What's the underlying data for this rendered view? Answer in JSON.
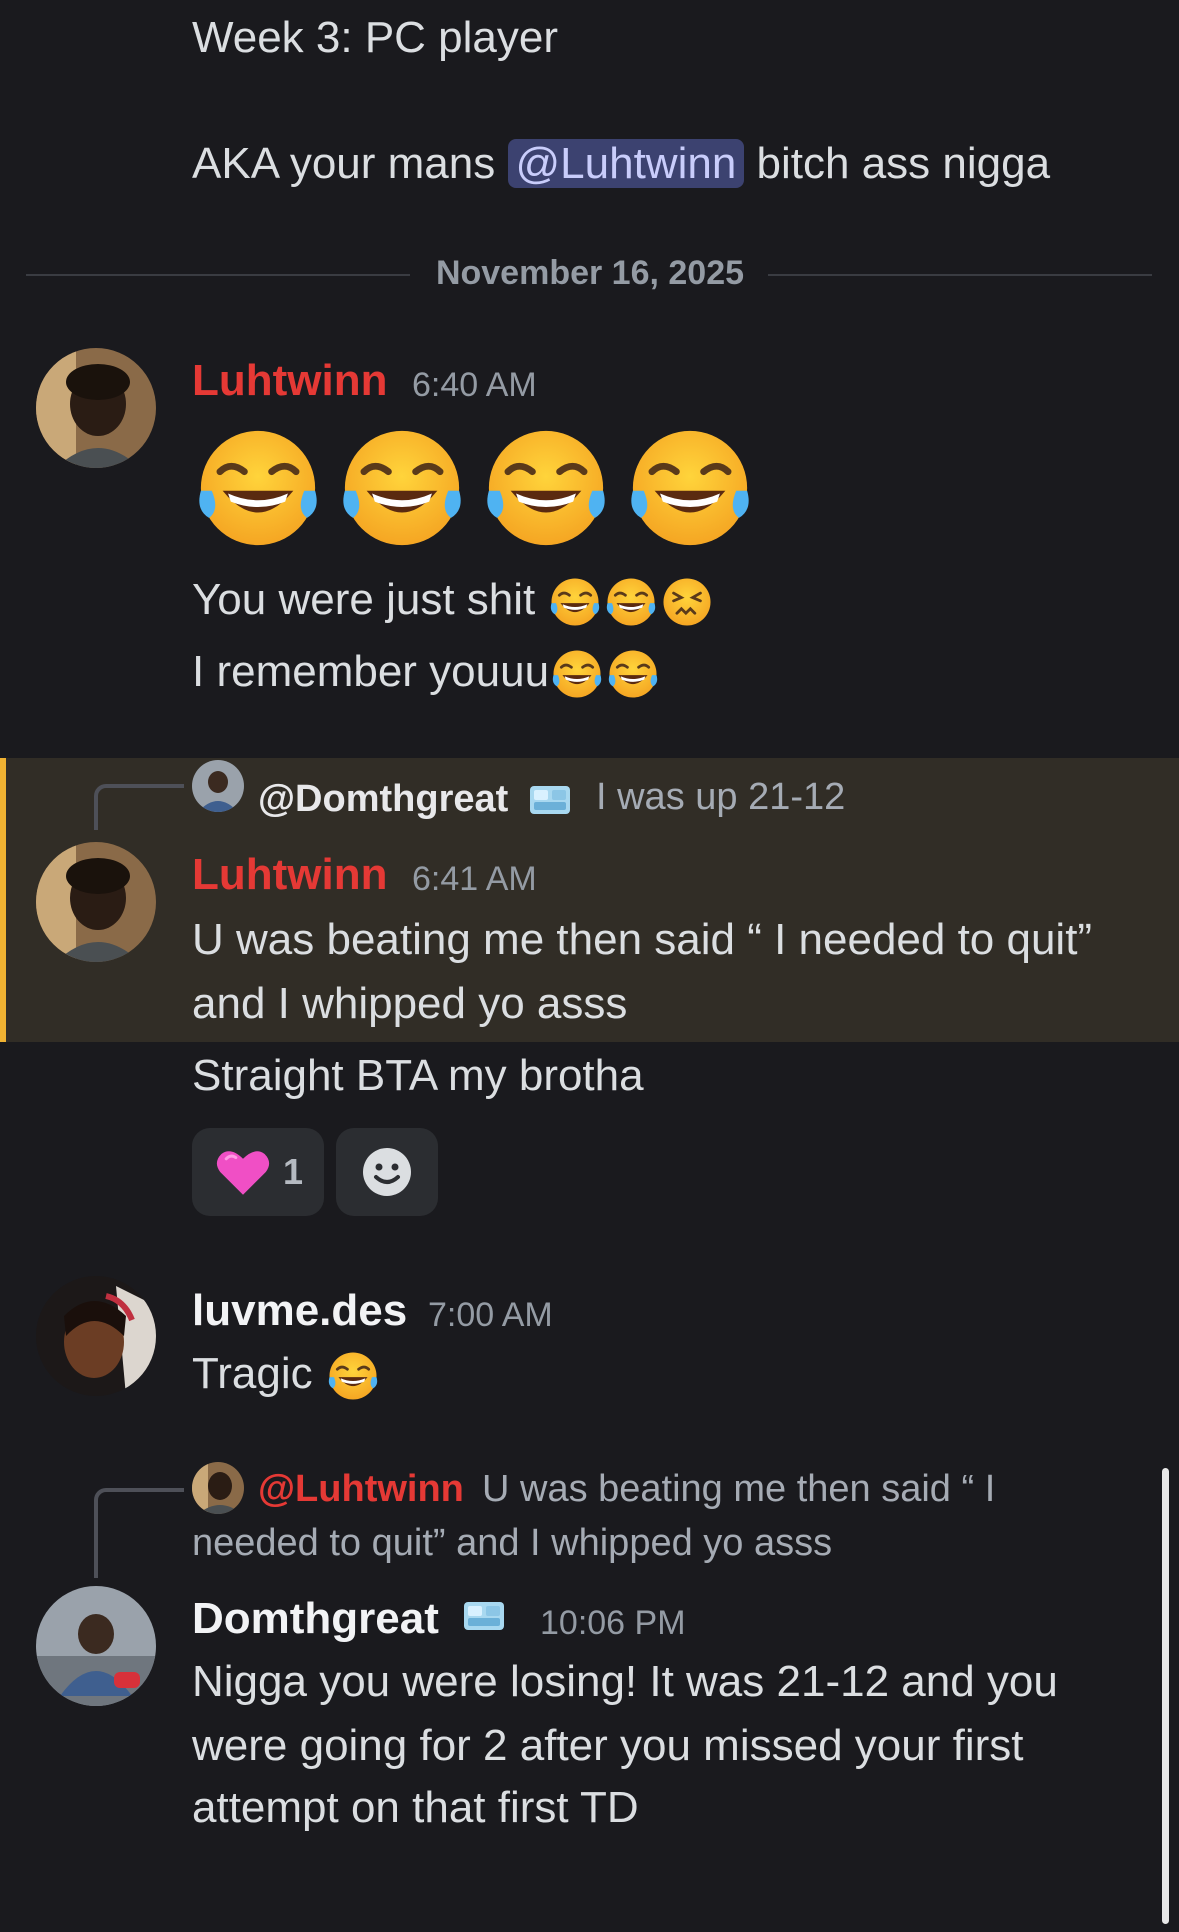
{
  "top_message": {
    "line1": "Week 3: PC player",
    "line2_prefix": "AKA your mans",
    "line2_mention": "@Luhtwinn",
    "line2_suffix": "bitch ass nigga"
  },
  "date_divider": "November 16, 2025",
  "messages": [
    {
      "username": "Luhtwinn",
      "time": "6:40 AM",
      "emoji_row": [
        "face-with-tears-of-joy",
        "face-with-tears-of-joy",
        "face-with-tears-of-joy",
        "face-with-tears-of-joy"
      ],
      "line1": "You were just shit",
      "line2": "I remember youuu"
    },
    {
      "reply_to": "@Domthgreat",
      "reply_text": "I was up 21-12",
      "username": "Luhtwinn",
      "time": "6:41 AM",
      "line1": "U was beating me then said “ I needed to quit”",
      "line2": "and I whipped yo asss",
      "line3": "Straight BTA my brotha",
      "reactions": [
        {
          "emoji": "pink-heart",
          "count": "1"
        },
        {
          "emoji": "add-reaction"
        }
      ]
    },
    {
      "username": "luvme.des",
      "time": "7:00 AM",
      "text": "Tragic"
    },
    {
      "reply_to": "@Luhtwinn",
      "reply_text_line1": "U was beating me then said “ I",
      "reply_text_line2": "needed to quit” and I whipped yo asss",
      "username": "Domthgreat",
      "time": "10:06 PM",
      "line1": "Nigga you were losing! It was 21-12 and you",
      "line2": "were going for 2 after you missed your first",
      "line3": "attempt on that first TD"
    }
  ],
  "colors": {
    "background": "#1a1a1e",
    "luhtwinn_name": "#e53935",
    "mention_bg": "#3c4270",
    "reply_highlight": "#312d26",
    "reply_bar": "#f0b232",
    "timestamp": "#949ba4"
  }
}
